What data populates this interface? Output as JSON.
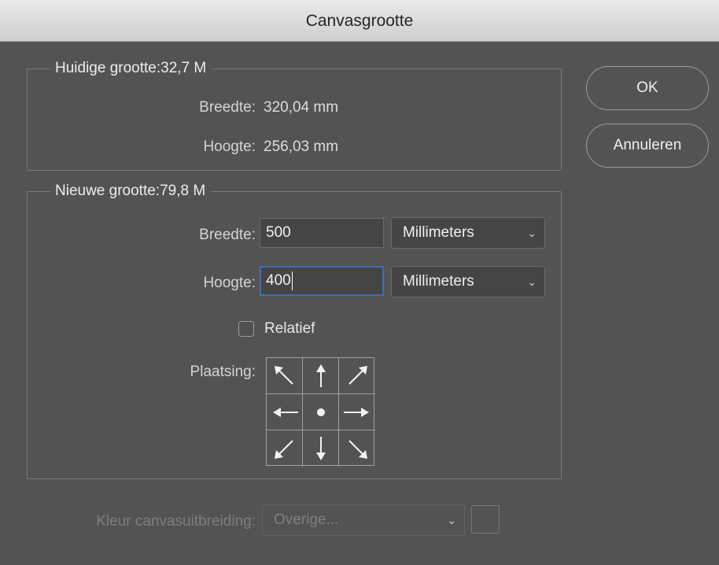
{
  "window": {
    "title": "Canvasgrootte"
  },
  "current": {
    "legend": "Huidige grootte:32,7 M",
    "width_label": "Breedte:",
    "width_value": "320,04 mm",
    "height_label": "Hoogte:",
    "height_value": "256,03 mm"
  },
  "new_size": {
    "legend": "Nieuwe grootte:79,8 M",
    "width_label": "Breedte:",
    "width_value": "500",
    "width_unit": "Millimeters",
    "height_label": "Hoogte:",
    "height_value": "400",
    "height_unit": "Millimeters",
    "relative_label": "Relatief",
    "relative_checked": false,
    "anchor_label": "Plaatsing:",
    "anchor_selected": "center"
  },
  "buttons": {
    "ok": "OK",
    "cancel": "Annuleren"
  },
  "extension": {
    "label": "Kleur canvasuitbreiding:",
    "value": "Overige..."
  },
  "colors": {
    "background": "#535353",
    "focus_border": "#3f6fb8",
    "titlebar": "#d9d9d9"
  }
}
